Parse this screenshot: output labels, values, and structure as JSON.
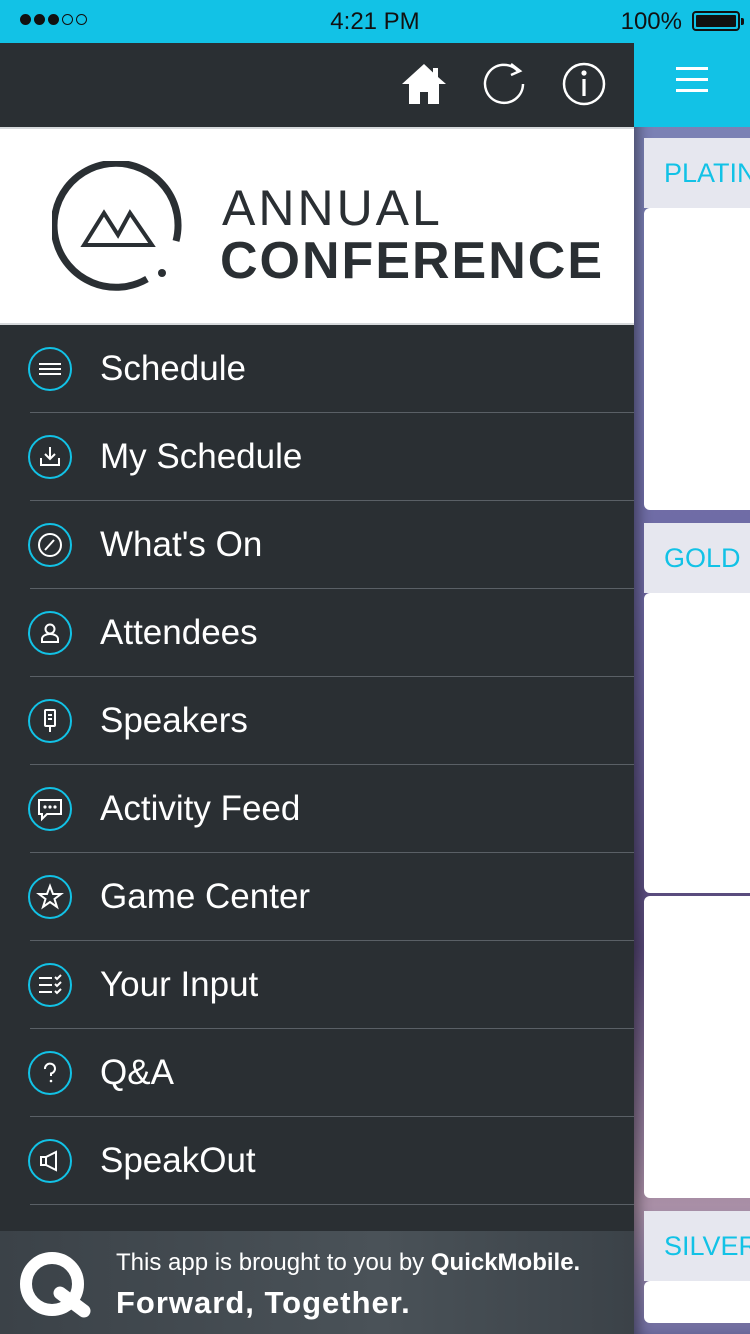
{
  "status_bar": {
    "time": "4:21 PM",
    "battery": "100%"
  },
  "toolbar": {
    "home_icon": "home-icon",
    "refresh_icon": "refresh-icon",
    "info_icon": "info-icon"
  },
  "logo": {
    "line1": "ANNUAL",
    "line2": "CONFERENCE"
  },
  "menu": {
    "items": [
      {
        "label": "Schedule",
        "icon": "list-icon"
      },
      {
        "label": "My Schedule",
        "icon": "download-icon"
      },
      {
        "label": "What's On",
        "icon": "compass-icon"
      },
      {
        "label": "Attendees",
        "icon": "person-icon"
      },
      {
        "label": "Speakers",
        "icon": "microphone-icon"
      },
      {
        "label": "Activity Feed",
        "icon": "chat-icon"
      },
      {
        "label": "Game Center",
        "icon": "star-icon"
      },
      {
        "label": "Your Input",
        "icon": "checklist-icon"
      },
      {
        "label": "Q&A",
        "icon": "question-icon"
      },
      {
        "label": "SpeakOut",
        "icon": "megaphone-icon"
      }
    ]
  },
  "banner": {
    "line1_prefix": "This app is brought to you by ",
    "line1_brand": "QuickMobile.",
    "line2": "Forward, Together."
  },
  "right_panel": {
    "sections": [
      "PLATIN",
      "GOLD",
      "SILVER"
    ]
  },
  "colors": {
    "accent": "#12c2e6",
    "drawer_bg": "#2a2f33"
  }
}
